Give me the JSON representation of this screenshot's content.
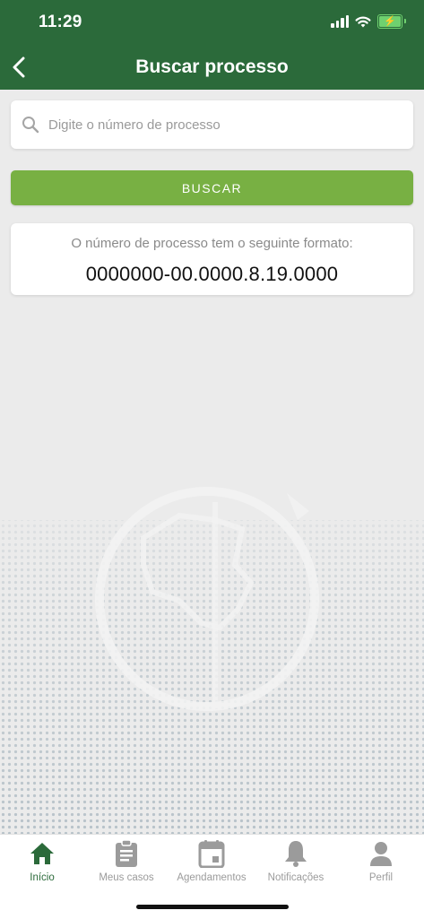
{
  "status_bar": {
    "time": "11:29"
  },
  "header": {
    "title": "Buscar processo",
    "back_icon": "chevron-left-icon",
    "background_color": "#2b6a3a"
  },
  "search": {
    "placeholder": "Digite o número de processo",
    "value": "",
    "icon": "search-icon"
  },
  "buscar_button": {
    "label": "BUSCAR",
    "color": "#78b043"
  },
  "format_card": {
    "label": "O número de processo tem o seguinte formato:",
    "value": "0000000-00.0000.8.19.0000"
  },
  "tabbar": {
    "items": [
      {
        "label": "Início",
        "icon": "home-icon",
        "active": true
      },
      {
        "label": "Meus casos",
        "icon": "clipboard-icon",
        "active": false
      },
      {
        "label": "Agendamentos",
        "icon": "calendar-icon",
        "active": false
      },
      {
        "label": "Notificações",
        "icon": "bell-icon",
        "active": false
      },
      {
        "label": "Perfil",
        "icon": "user-icon",
        "active": false
      }
    ],
    "active_color": "#2b6a3a",
    "inactive_color": "#9b9b9b"
  }
}
